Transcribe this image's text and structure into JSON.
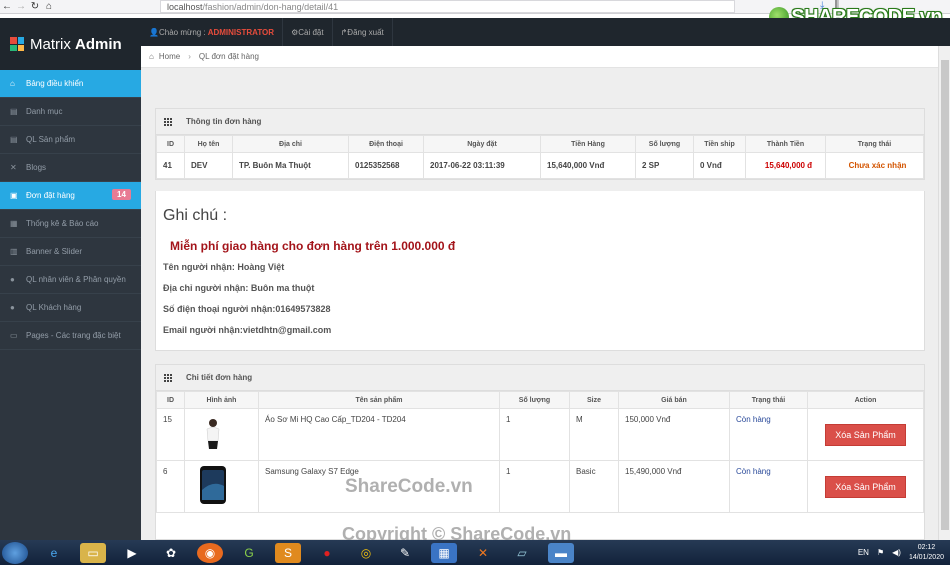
{
  "browser": {
    "url_host": "localhost",
    "url_path": "/fashion/admin/don-hang/detail/41"
  },
  "watermark_logo": "SHARECODE.vn",
  "app": {
    "brand_light": "Matrix",
    "brand_bold": "Admin",
    "welcome_label": "Chào mừng :",
    "welcome_user": "ADMINISTRATOR",
    "settings_label": "Cài đặt",
    "logout_label": "Đăng xuất"
  },
  "sidebar": {
    "items": [
      {
        "label": "Bảng điều khiển",
        "icon": "home-icon"
      },
      {
        "label": "Danh mục",
        "icon": "list-icon"
      },
      {
        "label": "QL Sản phẩm",
        "icon": "list-icon"
      },
      {
        "label": "Blogs",
        "icon": "blog-icon"
      },
      {
        "label": "Đơn đặt hàng",
        "icon": "cart-icon",
        "badge": "14"
      },
      {
        "label": "Thống kê & Báo cáo",
        "icon": "chart-icon"
      },
      {
        "label": "Banner & Slider",
        "icon": "image-icon"
      },
      {
        "label": "QL nhân viên & Phân quyền",
        "icon": "user-icon"
      },
      {
        "label": "QL Khách hàng",
        "icon": "user-icon"
      },
      {
        "label": "Pages - Các trang đặc biệt",
        "icon": "pages-icon"
      }
    ]
  },
  "breadcrumb": {
    "home": "Home",
    "current": "QL đơn đặt hàng"
  },
  "order_info": {
    "title": "Thông tin đơn hàng",
    "headers": [
      "ID",
      "Họ tên",
      "Địa chỉ",
      "Điện thoại",
      "Ngày đặt",
      "Tiền Hàng",
      "Số lượng",
      "Tiền ship",
      "Thành Tiền",
      "Trạng thái"
    ],
    "row": [
      "41",
      "DEV",
      "TP. Buôn Ma Thuột",
      "0125352568",
      "2017-06-22 03:11:39",
      "15,640,000 Vnđ",
      "2 SP",
      "0 Vnđ",
      "15,640,000 đ",
      "Chưa xác nhận"
    ]
  },
  "note": {
    "heading": "Ghi chú :",
    "promo": "Miễn phí giao hàng cho đơn hàng trên 1.000.000 đ",
    "lines": [
      "Tên người nhận: Hoàng Việt",
      "Địa chỉ người nhận: Buôn ma thuột",
      "Số điện thoại người nhận:01649573828",
      "Email người nhận:vietdhtn@gmail.com"
    ]
  },
  "order_detail": {
    "title": "Chi tiết đơn hàng",
    "headers": [
      "ID",
      "Hình ảnh",
      "Tên sản phẩm",
      "Số lượng",
      "Size",
      "Giá bán",
      "Trạng thái",
      "Action"
    ],
    "rows": [
      {
        "id": "15",
        "name": "Áo Sơ Mi HQ Cao Cấp_TD204 - TD204",
        "qty": "1",
        "size": "M",
        "price": "150,000 Vnđ",
        "status": "Còn hàng",
        "action": "Xóa Sản Phẩm",
        "thumb": "shirt-photo"
      },
      {
        "id": "6",
        "name": "Samsung Galaxy S7 Edge",
        "qty": "1",
        "size": "Basic",
        "price": "15,490,000 Vnđ",
        "status": "Còn hàng",
        "action": "Xóa Sản Phẩm",
        "thumb": "phone-photo"
      }
    ]
  },
  "watermarks": {
    "center": "ShareCode.vn",
    "bottom": "Copyright © ShareCode.vn"
  },
  "taskbar": {
    "lang": "EN",
    "time": "02:12",
    "date": "14/01/2020"
  }
}
